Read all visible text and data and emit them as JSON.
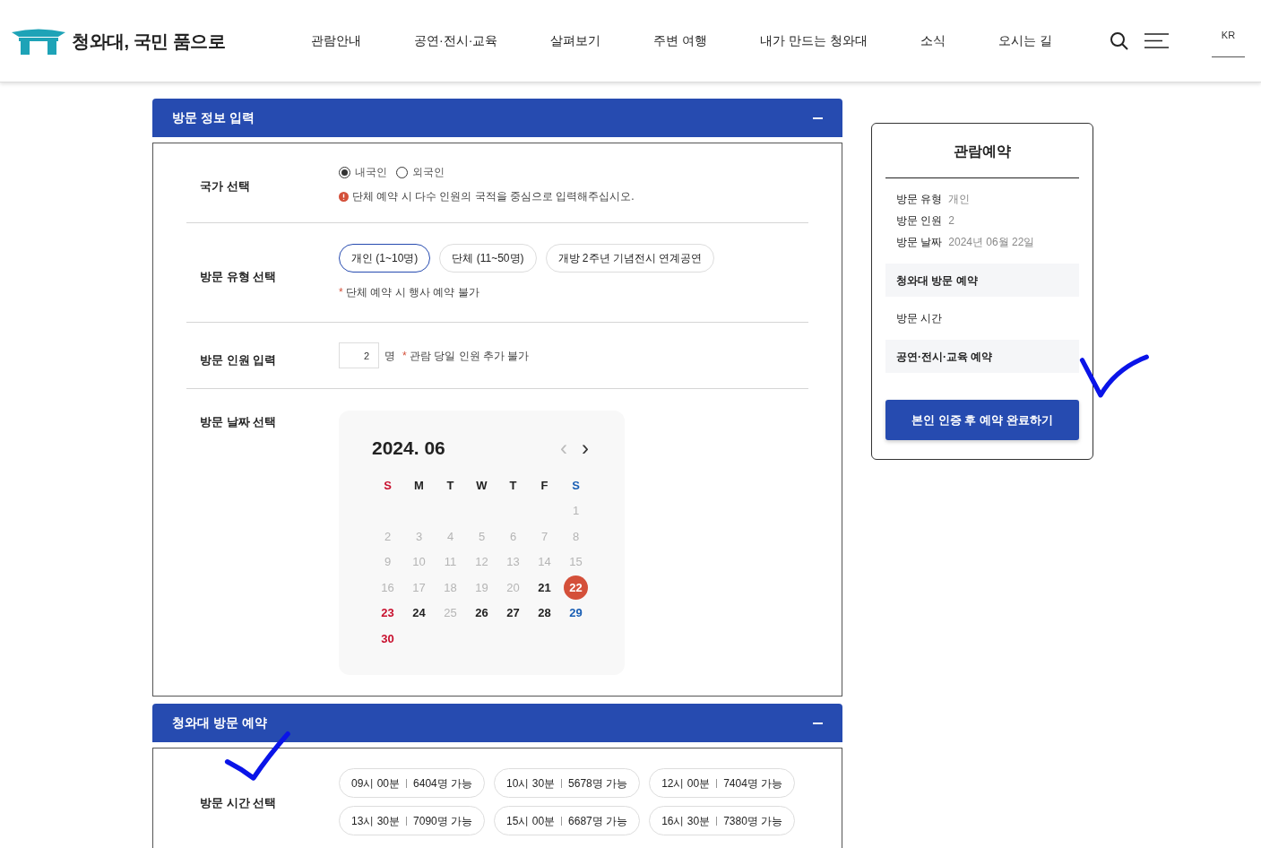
{
  "header": {
    "site_title": "청와대, 국민 품으로",
    "nav": [
      "관람안내",
      "공연·전시·교육",
      "살펴보기",
      "주변 여행",
      "내가 만드는 청와대",
      "소식",
      "오시는 길"
    ],
    "language": "KR"
  },
  "visit_info": {
    "title": "방문 정보 입력",
    "expanded": true,
    "country": {
      "label": "국가 선택",
      "options": [
        {
          "label": "내국인",
          "selected": true
        },
        {
          "label": "외국인",
          "selected": false
        }
      ],
      "notice": "단체 예약 시 다수 인원의 국적을 중심으로 입력해주십시오."
    },
    "visit_type": {
      "label": "방문 유형 선택",
      "options": [
        {
          "label": "개인 (1~10명)",
          "selected": true
        },
        {
          "label": "단체 (11~50명)",
          "selected": false
        },
        {
          "label": "개방 2주년 기념전시 연계공연",
          "selected": false
        }
      ],
      "note_mark": "*",
      "note": "단체 예약 시 행사 예약 불가"
    },
    "visitors": {
      "label": "방문 인원 입력",
      "value": "2",
      "unit": "명",
      "note_mark": "*",
      "note": "관람 당일 인원 추가 불가"
    },
    "date": {
      "label": "방문 날짜 선택",
      "calendar": {
        "month": "2024. 06",
        "prev": "‹",
        "next": "›",
        "weekdays": [
          {
            "label": "S",
            "color": "#c8102e"
          },
          {
            "label": "M",
            "color": "#222222"
          },
          {
            "label": "T",
            "color": "#222222"
          },
          {
            "label": "W",
            "color": "#222222"
          },
          {
            "label": "T",
            "color": "#222222"
          },
          {
            "label": "F",
            "color": "#222222"
          },
          {
            "label": "S",
            "color": "#1a5fb4"
          }
        ],
        "weeks": [
          [
            {
              "label": "1",
              "available": false,
              "selected": false
            }
          ],
          [
            {
              "label": "2",
              "available": false,
              "selected": false
            },
            {
              "label": "3",
              "available": false,
              "selected": false
            },
            {
              "label": "4",
              "available": false,
              "selected": false
            },
            {
              "label": "5",
              "available": false,
              "selected": false
            },
            {
              "label": "6",
              "available": false,
              "selected": false
            },
            {
              "label": "7",
              "available": false,
              "selected": false
            },
            {
              "label": "8",
              "available": false,
              "selected": false
            }
          ],
          [
            {
              "label": "9",
              "available": false,
              "selected": false
            },
            {
              "label": "10",
              "available": false,
              "selected": false
            },
            {
              "label": "11",
              "available": false,
              "selected": false
            },
            {
              "label": "12",
              "available": false,
              "selected": false
            },
            {
              "label": "13",
              "available": false,
              "selected": false
            },
            {
              "label": "14",
              "available": false,
              "selected": false
            },
            {
              "label": "15",
              "available": false,
              "selected": false
            }
          ],
          [
            {
              "label": "16",
              "available": false,
              "selected": false
            },
            {
              "label": "17",
              "available": false,
              "selected": false
            },
            {
              "label": "18",
              "available": false,
              "selected": false
            },
            {
              "label": "19",
              "available": false,
              "selected": false
            },
            {
              "label": "20",
              "available": false,
              "selected": false
            },
            {
              "label": "21",
              "available": true,
              "selected": false
            },
            {
              "label": "22",
              "available": true,
              "selected": true
            }
          ],
          [
            {
              "label": "23",
              "available": true,
              "selected": false
            },
            {
              "label": "24",
              "available": true,
              "selected": false
            },
            {
              "label": "25",
              "available": false,
              "selected": false
            },
            {
              "label": "26",
              "available": true,
              "selected": false
            },
            {
              "label": "27",
              "available": true,
              "selected": false
            },
            {
              "label": "28",
              "available": true,
              "selected": false
            },
            {
              "label": "29",
              "available": true,
              "selected": false
            }
          ],
          [
            {
              "label": "30",
              "available": true,
              "selected": false
            }
          ]
        ]
      }
    }
  },
  "visit_booking": {
    "title": "청와대 방문 예약",
    "expanded": true,
    "time_label": "방문 시간 선택",
    "slots": [
      {
        "time": "09시 00분",
        "capacity": "6404명 가능",
        "selected": false
      },
      {
        "time": "10시 30분",
        "capacity": "5678명 가능",
        "selected": false
      },
      {
        "time": "12시 00분",
        "capacity": "7404명 가능",
        "selected": false
      },
      {
        "time": "13시 30분",
        "capacity": "7090명 가능",
        "selected": false
      },
      {
        "time": "15시 00분",
        "capacity": "6687명 가능",
        "selected": false
      },
      {
        "time": "16시 30분",
        "capacity": "7380명 가능",
        "selected": false
      }
    ]
  },
  "summary": {
    "title": "관람예약",
    "rows": [
      {
        "label": "방문 유형",
        "value": "개인"
      },
      {
        "label": "방문 인원",
        "value": "2"
      },
      {
        "label": "방문 날짜",
        "value": "2024년 06월 22일"
      }
    ],
    "sections": [
      {
        "label": "청와대 방문 예약",
        "kind": "heading"
      },
      {
        "label": "방문 시간",
        "kind": "item"
      },
      {
        "label": "공연·전시·교육 예약",
        "kind": "heading"
      }
    ],
    "submit": "본인 인증 후 예약 완료하기"
  }
}
